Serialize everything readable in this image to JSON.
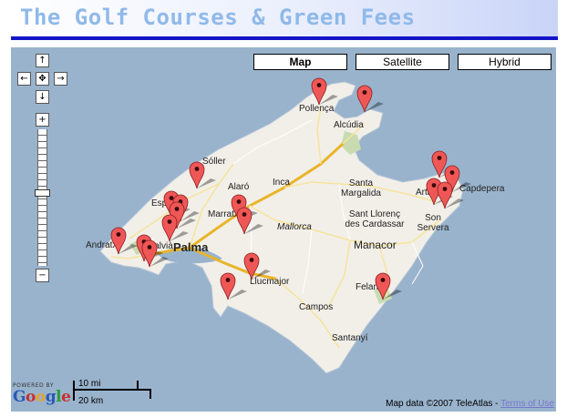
{
  "header": {
    "title": "The Golf Courses & Green Fees"
  },
  "map_types": {
    "map": "Map",
    "satellite": "Satellite",
    "hybrid": "Hybrid"
  },
  "nav": {
    "up_icon": "arrow-up-icon",
    "down_icon": "arrow-down-icon",
    "left_icon": "arrow-left-icon",
    "right_icon": "arrow-right-icon",
    "center_icon": "center-cross-icon"
  },
  "zoom": {
    "in": "+",
    "out": "−"
  },
  "scale": {
    "imperial": "10 mi",
    "metric": "20 km"
  },
  "branding": {
    "powered_by": "POWERED BY",
    "logo": "Google"
  },
  "attribution": {
    "text": "Map data ©2007 TeleAtlas - ",
    "link": "Terms of Use"
  },
  "places": {
    "pollenca": "Pollença",
    "alcudia": "Alcúdia",
    "soller": "Sóller",
    "alaro": "Alaró",
    "inca": "Inca",
    "santa_margalida": "Santa\nMargalida",
    "capdepera": "Capdepera",
    "arta": "Artà",
    "son_servera": "Son\nServera",
    "sant_llorenc": "Sant Llorenç\ndes Cardassar",
    "mallorca": "Mallorca",
    "manacor": "Manacor",
    "esporles": "Esporles",
    "marratxi": "Marratxí",
    "palma": "Palma",
    "andratx": "Andratx",
    "calvia": "Calvià",
    "llucmajor": "Llucmajor",
    "felanitx": "Felanitx",
    "campos": "Campos",
    "santanyi": "Santanyí"
  },
  "colors": {
    "sea": "#99b3cc",
    "land": "#f2efe9",
    "marker": "#ef5757",
    "title": "#8fb9ea",
    "rule": "#1414c8"
  }
}
